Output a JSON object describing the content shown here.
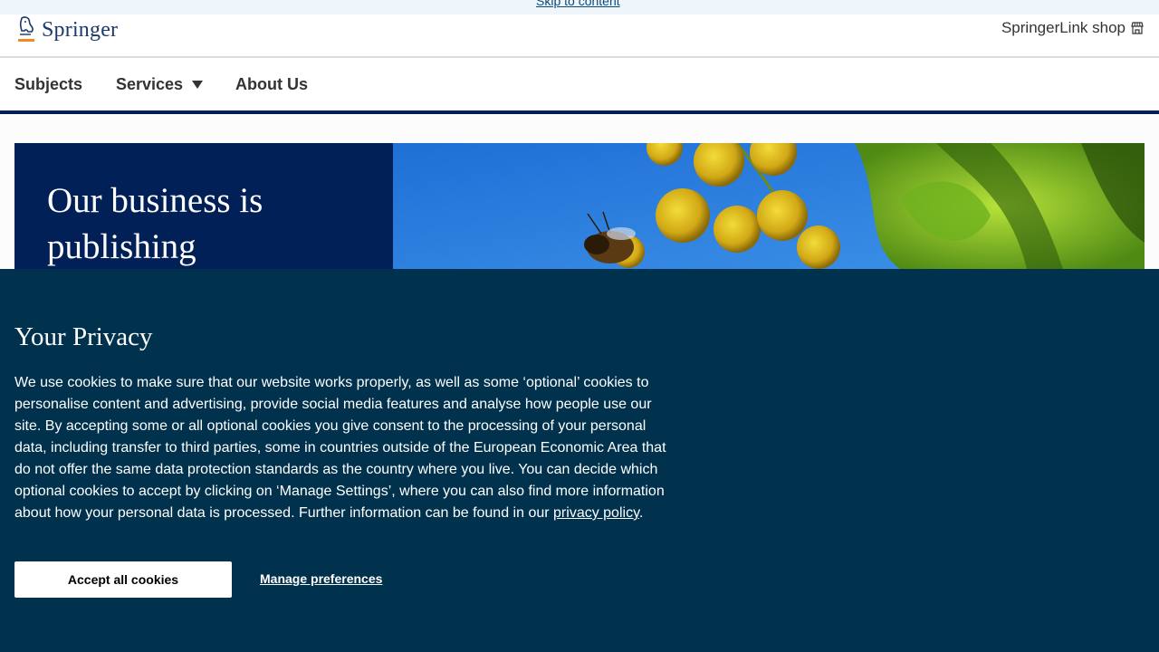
{
  "skip_link": "Skip to content",
  "header": {
    "brand": "Springer",
    "shop_label": "SpringerLink shop"
  },
  "nav": {
    "items": [
      "Subjects",
      "Services",
      "About Us"
    ]
  },
  "hero": {
    "title": "Our business is publishing"
  },
  "privacy": {
    "title": "Your Privacy",
    "body": "We use cookies to make sure that our website works properly, as well as some ‘optional’ cookies to personalise content and advertising, provide social media features and analyse how people use our site. By accepting some or all optional cookies you give consent to the processing of your personal data, including transfer to third parties, some in countries outside of the European Economic Area that do not offer the same data protection standards as the country where you live. You can decide which optional cookies to accept by clicking on ‘Manage Settings’, where you can also find more information about how your personal data is processed. Further information can be found in our",
    "policy_link": "privacy policy",
    "period": ".",
    "accept_label": "Accept all cookies",
    "manage_label": "Manage preferences"
  },
  "colors": {
    "brand_navy": "#012057",
    "banner_bg": "#00314d",
    "logo_orange": "#f08a24"
  },
  "icons": {
    "logo": "springer-horse-logo",
    "shop": "shop-icon",
    "dropdown": "caret-down-icon"
  }
}
